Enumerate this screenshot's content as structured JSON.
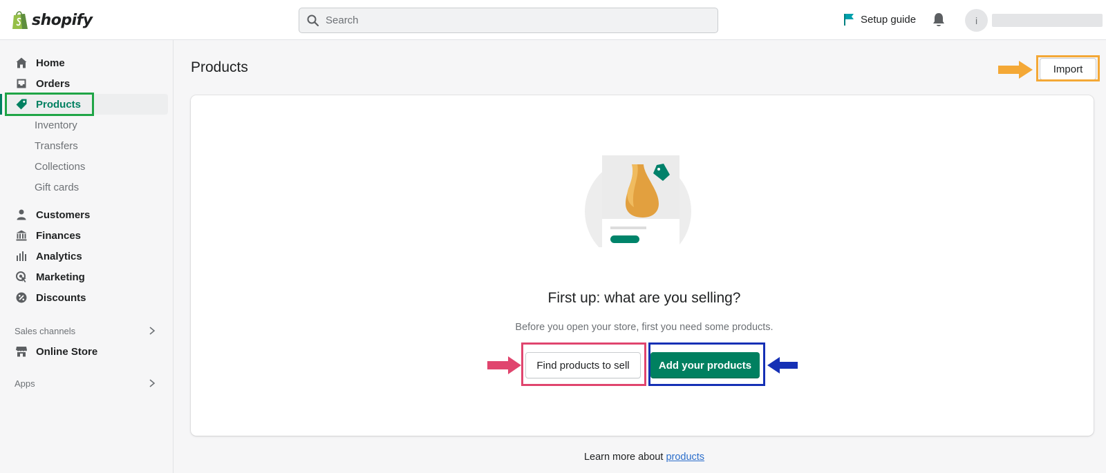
{
  "topbar": {
    "logo_text": "shopify",
    "search_placeholder": "Search",
    "setup_guide": "Setup guide",
    "avatar_initial": "i"
  },
  "sidebar": {
    "main_items": [
      {
        "label": "Home",
        "icon": "home-icon"
      },
      {
        "label": "Orders",
        "icon": "orders-icon"
      },
      {
        "label": "Products",
        "icon": "tag-icon",
        "active": true
      }
    ],
    "product_subitems": [
      "Inventory",
      "Transfers",
      "Collections",
      "Gift cards"
    ],
    "secondary_items": [
      {
        "label": "Customers",
        "icon": "person-icon"
      },
      {
        "label": "Finances",
        "icon": "bank-icon"
      },
      {
        "label": "Analytics",
        "icon": "bar-chart-icon"
      },
      {
        "label": "Marketing",
        "icon": "target-icon"
      },
      {
        "label": "Discounts",
        "icon": "discount-icon"
      }
    ],
    "sales_channels_label": "Sales channels",
    "online_store": {
      "label": "Online Store",
      "icon": "store-icon"
    },
    "apps_label": "Apps"
  },
  "main": {
    "page_title": "Products",
    "import_button": "Import",
    "empty_state": {
      "heading": "First up: what are you selling?",
      "subtext": "Before you open your store, first you need some products.",
      "find_button": "Find products to sell",
      "add_button": "Add your products"
    },
    "footer_text": "Learn more about",
    "footer_link": "products"
  },
  "colors": {
    "brand_green": "#008060",
    "sidebar_highlight_box": "#1fa546",
    "import_highlight": "#f4a836",
    "find_highlight": "#e0456e",
    "add_highlight": "#1530b5"
  }
}
